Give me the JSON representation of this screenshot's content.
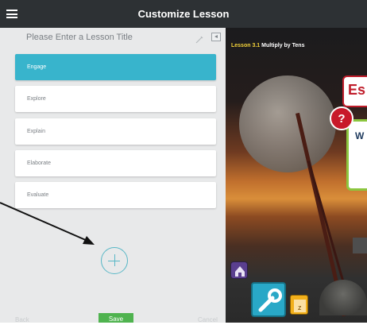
{
  "header": {
    "title": "Customize Lesson",
    "menu_icon": "hamburger-menu-icon"
  },
  "editor": {
    "lesson_title_placeholder": "Please Enter a Lesson Title",
    "edit_icon": "pencil-icon",
    "collapse_icon": "collapse-panel-icon",
    "sections": [
      {
        "label": "Engage",
        "active": true
      },
      {
        "label": "Explore",
        "active": false
      },
      {
        "label": "Explain",
        "active": false
      },
      {
        "label": "Elaborate",
        "active": false
      },
      {
        "label": "Evaluate",
        "active": false
      }
    ],
    "add_icon": "plus-circle-icon"
  },
  "footer": {
    "back_label": "Back",
    "save_label": "Save",
    "cancel_label": "Cancel"
  },
  "preview": {
    "lesson_number": "Lesson 3.1",
    "lesson_name": "Multiply by Tens",
    "badge_text": "Es",
    "question_mark": "?",
    "bubble_text": "W",
    "app_icons": [
      "home-icon",
      "wrench-icon",
      "a-to-z-icon"
    ]
  },
  "colors": {
    "topbar": "#2d3134",
    "active_section": "#38b4cc",
    "save_button": "#4fb34f",
    "accent_plus": "#58b7c6"
  }
}
